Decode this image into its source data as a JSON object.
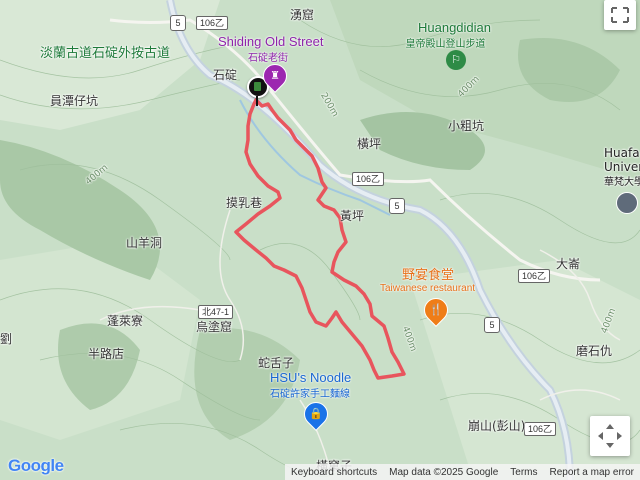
{
  "labels": {
    "top_left_partial": "淡蘭古道石碇外按古道",
    "stone_ding": "石碇",
    "yuanze": "員潭仔坑",
    "mozuchuan": "摸乳巷",
    "shanyangdong": "山羊洞",
    "penglailiao": "蓬萊寮",
    "banlu": "半路店",
    "wutuku": "烏塗窟",
    "liu": "劉",
    "sheshezi": "蛇舌子",
    "huangping_lower": "黃坪",
    "hengping": "橫坪",
    "xiaocukeng": "小粗坑",
    "yongyu": "湧窟",
    "daluan": "大崙",
    "moshilun": "磨石仇",
    "benshan": "崩山(彭山)",
    "jianzai": "橫窠子",
    "huafan_1": "Huafa",
    "huafan_2": "Univers",
    "huafan_3": "華梵大學",
    "road_106_top": "106乙",
    "road_106_mid": "106乙",
    "road_106_right": "106乙",
    "road_106_bottom": "106乙",
    "road_bei47": "北47-1",
    "road_5_top": "5",
    "road_5_mid": "5",
    "road_5_low": "5",
    "elev_200": "200m",
    "elev_400a": "400m",
    "elev_400b": "400m",
    "elev_400c": "400m",
    "elev_400d": "400m"
  },
  "pois": {
    "shiding_old_street": {
      "name": "Shiding Old Street",
      "sub": "石碇老街"
    },
    "huangdidian": {
      "name": "Huangdidian",
      "sub": "皇帝殿山登山步道"
    },
    "yeyan": {
      "name": "野宴食堂",
      "sub": "Taiwanese restaurant"
    },
    "hsu_noodle": {
      "name": "HSU's Noodle",
      "sub": "石碇許家手工麵線"
    }
  },
  "footer": {
    "shortcuts": "Keyboard shortcuts",
    "mapdata": "Map data ©2025 Google",
    "terms": "Terms",
    "report": "Report a map error"
  },
  "brand": {
    "logo": "Google"
  },
  "colors": {
    "route": "#e8555d",
    "road_highway": "#b8c8d8",
    "terrain": "#c9dfc8"
  }
}
